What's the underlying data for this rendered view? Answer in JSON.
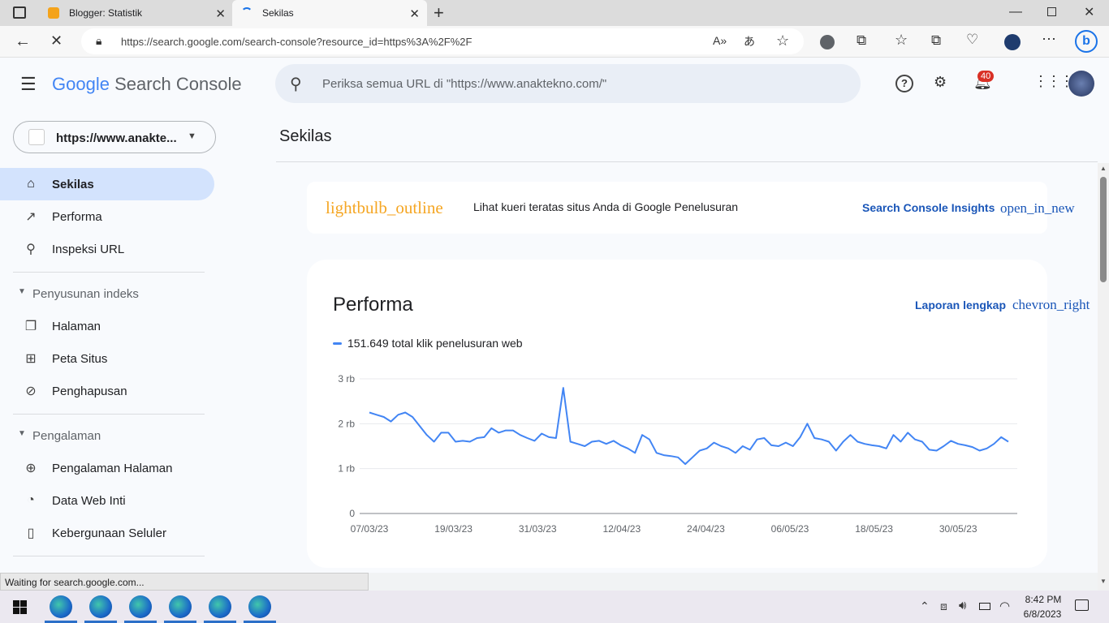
{
  "browser": {
    "tabs": [
      {
        "title": "Blogger: Statistik"
      },
      {
        "title": "Sekilas"
      }
    ],
    "url": "https://search.google.com/search-console?resource_id=https%3A%2F%2F",
    "status_text": "Waiting for search.google.com..."
  },
  "header": {
    "logo_google": "Google",
    "logo_product": "Search Console",
    "search_placeholder": "Periksa semua URL di \"https://www.anaktekno.com/\"",
    "notification_count": "40"
  },
  "sidebar": {
    "property": "https://www.anakte...",
    "items": [
      {
        "label": "Sekilas",
        "icon": "home-icon",
        "active": true
      },
      {
        "label": "Performa",
        "icon": "trending-icon"
      },
      {
        "label": "Inspeksi URL",
        "icon": "search-icon"
      }
    ],
    "section_index": {
      "title": "Penyusunan indeks",
      "items": [
        {
          "label": "Halaman",
          "icon": "pages-icon"
        },
        {
          "label": "Peta Situs",
          "icon": "sitemap-icon"
        },
        {
          "label": "Penghapusan",
          "icon": "visibility-off-icon"
        }
      ]
    },
    "section_experience": {
      "title": "Pengalaman",
      "items": [
        {
          "label": "Pengalaman Halaman",
          "icon": "add-circle-icon"
        },
        {
          "label": "Data Web Inti",
          "icon": "speed-icon"
        },
        {
          "label": "Kebergunaan Seluler",
          "icon": "phone-icon"
        }
      ]
    }
  },
  "main": {
    "page_title": "Sekilas",
    "insights_card": {
      "icon_text": "lightbulb_outline",
      "text": "Lihat kueri teratas situs Anda di Google Penelusuran",
      "link": "Search Console Insights",
      "link_icon_text": "open_in_new"
    },
    "performance_card": {
      "title": "Performa",
      "report_link": "Laporan lengkap",
      "report_icon_text": "chevron_right",
      "legend": "151.649 total klik penelusuran web"
    }
  },
  "chart_data": {
    "type": "line",
    "ylim": [
      0,
      3000
    ],
    "y_ticks": [
      {
        "value": 0,
        "label": "0"
      },
      {
        "value": 1000,
        "label": "1 rb"
      },
      {
        "value": 2000,
        "label": "2 rb"
      },
      {
        "value": 3000,
        "label": "3 rb"
      }
    ],
    "x_tick_labels": [
      "07/03/23",
      "19/03/23",
      "31/03/23",
      "12/04/23",
      "24/04/23",
      "06/05/23",
      "18/05/23",
      "30/05/23"
    ],
    "series": [
      {
        "name": "151.649 total klik penelusuran web",
        "color": "#4285f4",
        "values": [
          2250,
          2200,
          2150,
          2050,
          2200,
          2250,
          2150,
          1950,
          1750,
          1600,
          1800,
          1800,
          1600,
          1620,
          1600,
          1680,
          1700,
          1900,
          1800,
          1850,
          1850,
          1750,
          1680,
          1620,
          1780,
          1700,
          1680,
          2800,
          1600,
          1550,
          1500,
          1600,
          1620,
          1550,
          1620,
          1520,
          1450,
          1350,
          1750,
          1650,
          1350,
          1300,
          1280,
          1250,
          1100,
          1250,
          1400,
          1450,
          1580,
          1500,
          1450,
          1350,
          1500,
          1420,
          1650,
          1680,
          1520,
          1500,
          1580,
          1500,
          1700,
          2000,
          1680,
          1650,
          1600,
          1400,
          1600,
          1750,
          1600,
          1550,
          1520,
          1500,
          1450,
          1750,
          1600,
          1800,
          1650,
          1600,
          1420,
          1400,
          1500,
          1620,
          1550,
          1520,
          1480,
          1400,
          1450,
          1550,
          1700,
          1600
        ]
      }
    ]
  },
  "taskbar": {
    "time": "8:42 PM",
    "date": "6/8/2023"
  }
}
